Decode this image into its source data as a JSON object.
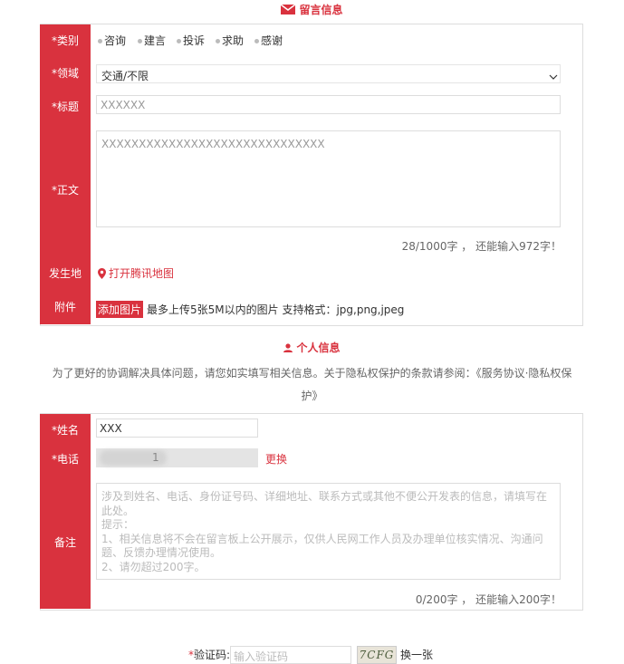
{
  "message_section": {
    "title": "留言信息",
    "fields": {
      "category_label": "*类别",
      "category_options": [
        "咨询",
        "建言",
        "投诉",
        "求助",
        "感谢"
      ],
      "domain_label": "*领域",
      "domain_value": "交通/不限",
      "title_label": "*标题",
      "title_value": "XXXXXX",
      "body_label": "*正文",
      "body_value": "XXXXXXXXXXXXXXXXXXXXXXXXXXXXXX",
      "body_counter": "28/1000字 ， 还能输入972字！",
      "location_label": "发生地",
      "location_link": "打开腾讯地图",
      "attachment_label": "附件",
      "attachment_button": "添加图片",
      "attachment_hint": "最多上传5张5M以内的图片 支持格式：jpg,png,jpeg"
    }
  },
  "personal_section": {
    "title": "个人信息",
    "notice_line1": "为了更好的协调解决具体问题，请您如实填写相关信息。关于隐私权保护的条款请参阅：《服务协议·隐私权保",
    "notice_line2": "护》",
    "fields": {
      "name_label": "*姓名",
      "name_value": "XXX",
      "phone_label": "*电话",
      "phone_value": "1",
      "phone_change": "更换",
      "remark_label": "备注",
      "remark_placeholder_lines": [
        "涉及到姓名、电话、身份证号码、详细地址、联系方式或其他不便公开发表的信息，请填写在",
        "此处。",
        "提示：",
        "1、相关信息将不会在留言板上公开展示，仅供人民网工作人员及办理单位核实情况、沟通问",
        "题、反馈办理情况使用。",
        "2、请勿超过200字。"
      ],
      "remark_counter": "0/200字 ， 还能输入200字！"
    }
  },
  "captcha": {
    "label": "*验证码:",
    "placeholder": "输入验证码",
    "image_text": "7CFG",
    "refresh": "换一张"
  },
  "colors": {
    "accent": "#d9323e",
    "border": "#dddddd"
  }
}
